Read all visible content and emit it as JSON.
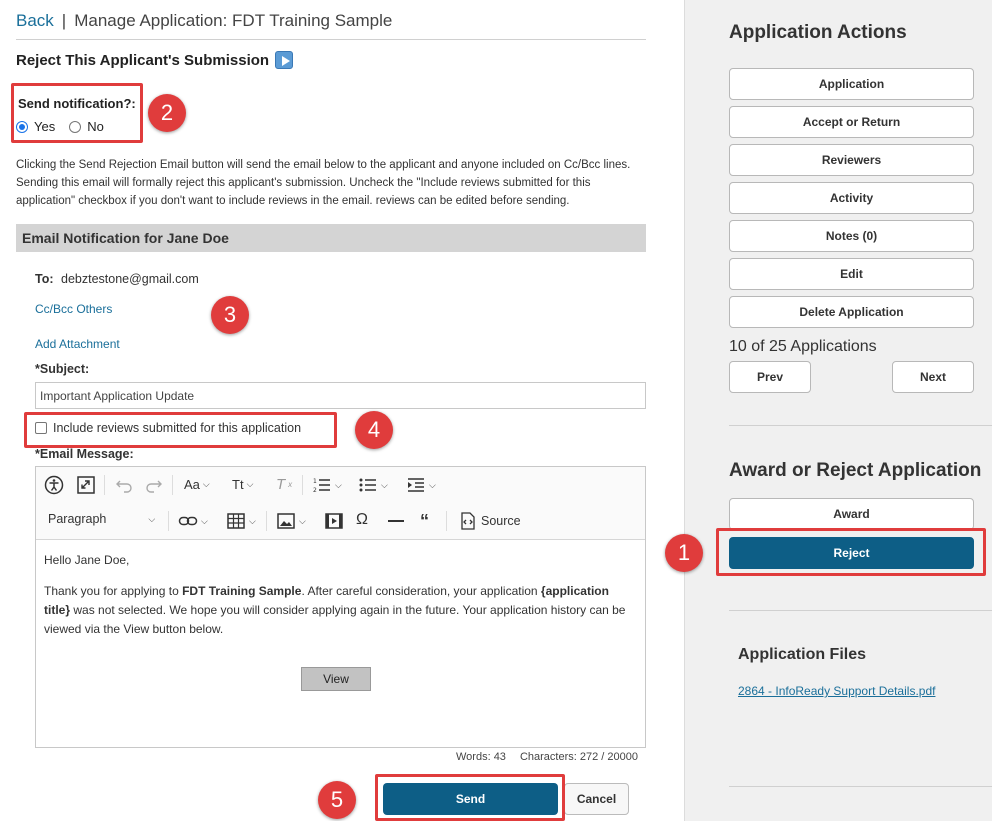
{
  "header": {
    "back_label": "Back",
    "separator": "|",
    "title": "Manage Application: FDT Training Sample"
  },
  "reject_section": {
    "title": "Reject This Applicant's Submission",
    "play_icon": "play-video-icon"
  },
  "notification": {
    "label": "Send notification?:",
    "options": [
      {
        "label": "Yes",
        "checked": true
      },
      {
        "label": "No",
        "checked": false
      }
    ]
  },
  "instructions": "Clicking the Send Rejection Email button will send the email below to the applicant and anyone included on Cc/Bcc lines. Sending this email will formally reject this applicant's submission. Uncheck the \"Include reviews submitted for this application\" checkbox if you don't want to include reviews in the email. reviews can be edited before sending.",
  "email": {
    "bar_title": "Email Notification for Jane Doe",
    "to_label": "To:",
    "to_value": "debztestone@gmail.com",
    "cc_link": "Cc/Bcc Others",
    "attach_link": "Add Attachment",
    "subject_label": "*Subject:",
    "subject_value": "Important Application Update",
    "include_reviews_label": "Include reviews submitted for this application",
    "include_reviews_checked": false,
    "message_label": "*Email Message:"
  },
  "editor": {
    "toolbar_row1": [
      "accessibility-icon",
      "fullscreen-icon",
      "undo-icon",
      "redo-icon",
      "font-family-icon",
      "font-size-icon",
      "remove-format-icon",
      "numbered-list-icon",
      "bulleted-list-icon",
      "indent-icon"
    ],
    "font_family_glyph": "Aa",
    "font_size_glyph": "Tt",
    "remove_format_glyph": "T",
    "paragraph_label": "Paragraph",
    "source_label": "Source",
    "body": {
      "greeting": "Hello Jane Doe,",
      "p_prefix": "Thank you for applying to ",
      "p_bold1": "FDT Training Sample",
      "p_mid": ". After careful consideration, your application ",
      "p_bold2": "{application title}",
      "p_suffix": " was not selected. We hope you will consider applying again in the future. Your application history can be viewed via the View button below.",
      "view_label": "View"
    },
    "words": "Words: 43",
    "characters": "Characters: 272 / 20000"
  },
  "buttons": {
    "send": "Send",
    "cancel": "Cancel"
  },
  "markers": {
    "m1": "1",
    "m2": "2",
    "m3": "3",
    "m4": "4",
    "m5": "5"
  },
  "sidebar": {
    "actions_title": "Application Actions",
    "actions": [
      "Application",
      "Accept or Return",
      "Reviewers",
      "Activity",
      "Notes (0)",
      "Edit",
      "Delete Application"
    ],
    "count_text": "10 of 25 Applications",
    "prev": "Prev",
    "next": "Next",
    "award_title": "Award or Reject Application",
    "award": "Award",
    "reject": "Reject",
    "files_title": "Application Files",
    "file_link": "2864 - InfoReady Support Details.pdf"
  },
  "colors": {
    "accent": "#0d5e86",
    "link": "#1a6f9a",
    "annotation": "#e03c3c"
  }
}
